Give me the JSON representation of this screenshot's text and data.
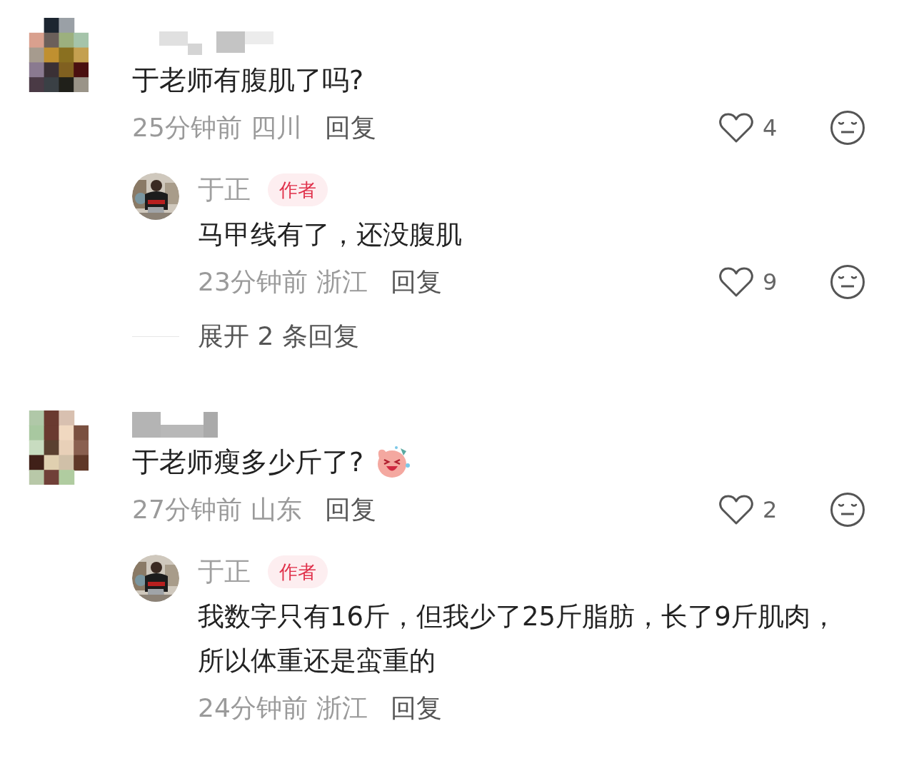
{
  "comments": [
    {
      "avatar": {
        "kind": "picture"
      },
      "text": "于老师有腹肌了吗?",
      "has_emoji": false,
      "time": "25分钟前",
      "region": "四川",
      "reply_label": "回复",
      "likes": "4",
      "replies": [
        {
          "author": "于正",
          "badge": "作者",
          "text": "马甲线有了，还没腹肌",
          "time": "23分钟前",
          "region": "浙江",
          "reply_label": "回复",
          "likes": "9"
        }
      ],
      "expand_label": "展开 2 条回复"
    },
    {
      "avatar": {
        "kind": "picture"
      },
      "text": "于老师瘦多少斤了?",
      "has_emoji": true,
      "time": "27分钟前",
      "region": "山东",
      "reply_label": "回复",
      "likes": "2",
      "replies": [
        {
          "author": "于正",
          "badge": "作者",
          "text": "我数字只有16斤，但我少了25斤脂肪，长了9斤肌肉，所以体重还是蛮重的",
          "time": "24分钟前",
          "region": "浙江",
          "reply_label": "回复"
        }
      ]
    }
  ]
}
